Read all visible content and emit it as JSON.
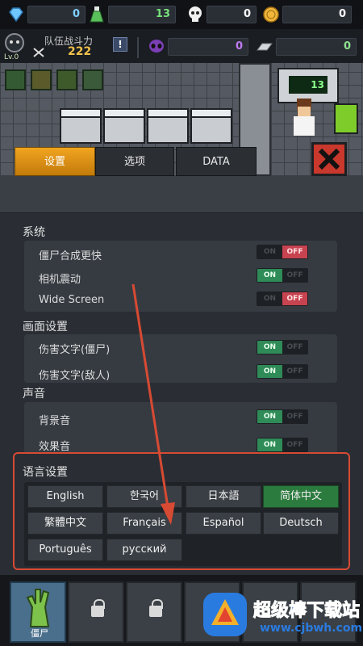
{
  "resources": {
    "gems": "0",
    "potion": "13",
    "skulls": "0",
    "coins": "0",
    "alien": "0",
    "material": "0"
  },
  "player": {
    "level": "Lv.0",
    "team_label": "队伍战斗力",
    "team_power": "222",
    "info": "!"
  },
  "scene": {
    "counter": "13"
  },
  "tabs": [
    "设置",
    "选项",
    "DATA"
  ],
  "settings": {
    "system": {
      "title": "系统",
      "rows": [
        {
          "label": "僵尸合成更快",
          "state": "OFF"
        },
        {
          "label": "相机震动",
          "state": "ON"
        },
        {
          "label": "Wide Screen",
          "state": "OFF"
        }
      ]
    },
    "display": {
      "title": "画面设置",
      "rows": [
        {
          "label": "伤害文字(僵尸)",
          "state": "ON"
        },
        {
          "label": "伤害文字(敌人)",
          "state": "ON"
        }
      ]
    },
    "sound": {
      "title": "声音",
      "rows": [
        {
          "label": "背景音",
          "state": "ON"
        },
        {
          "label": "效果音",
          "state": "ON"
        }
      ]
    },
    "language": {
      "title": "语言设置",
      "selected": "简体中文",
      "options": [
        "English",
        "한국어",
        "日本語",
        "简体中文",
        "繁體中文",
        "Français",
        "Español",
        "Deutsch",
        "Português",
        "русский"
      ]
    }
  },
  "toggle_text": {
    "on": "ON",
    "off": "OFF"
  },
  "bottom": {
    "first_slot_label": "僵尸"
  },
  "watermark": {
    "title": "超级棒下载站",
    "url": "www.cjbwh.com"
  },
  "colors": {
    "accent_tab": "#f2a520",
    "toggle_on": "#2f8b57",
    "toggle_off": "#c74350",
    "highlight_border": "#d74a33",
    "selected_lang": "#2b7a3e"
  }
}
